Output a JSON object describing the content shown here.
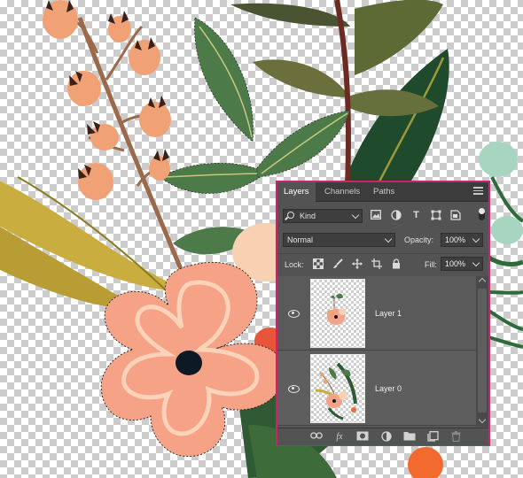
{
  "panel": {
    "tabs": [
      "Layers",
      "Channels",
      "Paths"
    ],
    "active_tab": "Layers",
    "filter": {
      "kind_label": "Kind",
      "icons": [
        "pixel-filter-icon",
        "adjustment-filter-icon",
        "type-filter-icon",
        "shape-filter-icon",
        "smart-object-filter-icon"
      ],
      "type_glyph": "T"
    },
    "blend_mode": "Normal",
    "opacity_label": "Opacity:",
    "opacity_value": "100%",
    "lock_label": "Lock:",
    "fill_label": "Fill:",
    "fill_value": "100%",
    "layers": [
      {
        "name": "Layer 1",
        "visible": true
      },
      {
        "name": "Layer 0",
        "visible": true
      }
    ],
    "footer_fx": "fx",
    "accent_border": "#d1206f"
  }
}
